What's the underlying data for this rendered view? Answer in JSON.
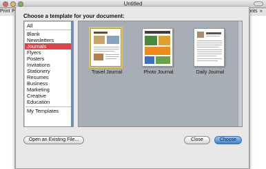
{
  "window": {
    "title": "Untitled"
  },
  "toolbar": {
    "print_label": "Print",
    "pa_label": "Pa",
    "fonts_label": "Fonts",
    "more_label": "»"
  },
  "sheet": {
    "heading": "Choose a template for your document:",
    "categories": [
      {
        "label": "All"
      },
      {
        "label": "Blank"
      },
      {
        "label": "Newsletters"
      },
      {
        "label": "Journals",
        "selected": true
      },
      {
        "label": "Flyers"
      },
      {
        "label": "Posters"
      },
      {
        "label": "Invitations"
      },
      {
        "label": "Stationery"
      },
      {
        "label": "Resumes"
      },
      {
        "label": "Business"
      },
      {
        "label": "Marketing"
      },
      {
        "label": "Creative"
      },
      {
        "label": "Education"
      },
      {
        "label": "My Templates"
      }
    ],
    "templates": [
      {
        "name": "Travel Journal",
        "selected": true
      },
      {
        "name": "Photo Journal",
        "selected": false
      },
      {
        "name": "Daily Journal",
        "selected": false
      }
    ],
    "buttons": {
      "open_existing": "Open an Existing File...",
      "close": "Close",
      "choose": "Choose"
    }
  },
  "colors": {
    "selection": "#e0424a",
    "accent": "#3f7fd6",
    "preview_bg": "#a8aeb5"
  }
}
